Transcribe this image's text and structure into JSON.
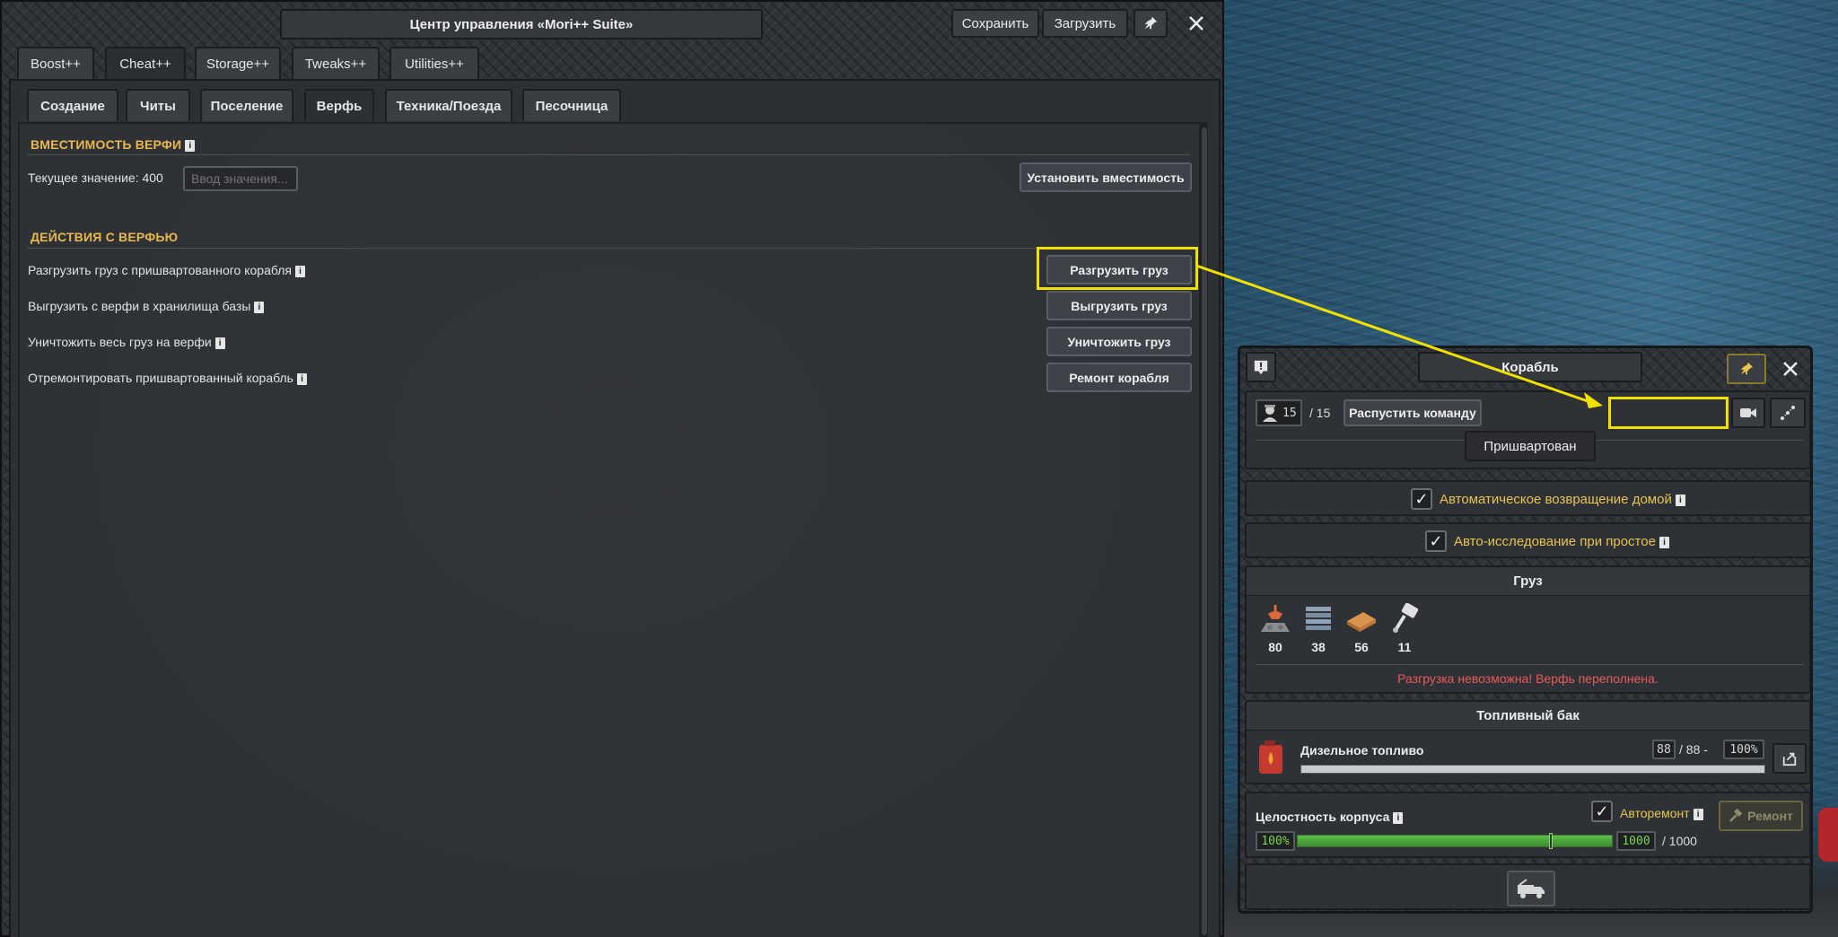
{
  "window": {
    "title": "Центр управления «Mori++ Suite»",
    "save_label": "Сохранить",
    "load_label": "Загрузить"
  },
  "tabs": [
    "Boost++",
    "Cheat++",
    "Storage++",
    "Tweaks++",
    "Utilities++"
  ],
  "active_tab": "Cheat++",
  "subtabs": [
    "Создание",
    "Читы",
    "Поселение",
    "Верфь",
    "Техника/Поезда",
    "Песочница"
  ],
  "active_subtab": "Верфь",
  "capacity": {
    "title": "ВМЕСТИМОСТЬ ВЕРФИ",
    "info": "i",
    "current_label": "Текущее значение: 400",
    "input_placeholder": "Ввод значения...",
    "set_button": "Установить вместимость"
  },
  "actions": {
    "title": "ДЕЙСТВИЯ С ВЕРФЬЮ",
    "info": "i",
    "rows": [
      {
        "label": "Разгрузить груз с пришвартованного корабля",
        "button": "Разгрузить груз"
      },
      {
        "label": "Выгрузить с верфи в хранилища базы",
        "button": "Выгрузить груз"
      },
      {
        "label": "Уничтожить весь груз на верфи",
        "button": "Уничтожить груз"
      },
      {
        "label": "Отремонтировать пришвартованный корабль",
        "button": "Ремонт корабля"
      }
    ]
  },
  "ship": {
    "title": "Корабль",
    "crew_current": "15",
    "crew_max": "/ 15",
    "dismiss_button": "Распустить команду",
    "status": "Пришвартован",
    "auto_return": "Автоматическое возвращение домой",
    "auto_explore": "Авто-исследование при простое",
    "info": "i",
    "cargo": {
      "title": "Груз",
      "items": [
        {
          "icon": "crane-icon",
          "value": "80"
        },
        {
          "icon": "steel-stack-icon",
          "value": "38"
        },
        {
          "icon": "planks-icon",
          "value": "56"
        },
        {
          "icon": "mechanical-parts-icon",
          "value": "11"
        }
      ],
      "warning": "Разгрузка невозможна! Верфь переполнена."
    },
    "fuel": {
      "title": "Топливный бак",
      "name": "Дизельное топливо",
      "amount": "88",
      "max": "/ 88 -",
      "percent": "100%",
      "fill_fraction": 1.0
    },
    "hull": {
      "label": "Целостность корпуса",
      "auto_repair": "Авторемонт",
      "repair_button": "Ремонт",
      "percent": "100%",
      "value": "1000",
      "max": "/ 1000",
      "fill_fraction": 1.0
    }
  },
  "colors": {
    "accent_yellow": "#f1e100",
    "section_title": "#e8b84a",
    "warning_red": "#e85a5a",
    "health_green": "#4fa83a"
  }
}
